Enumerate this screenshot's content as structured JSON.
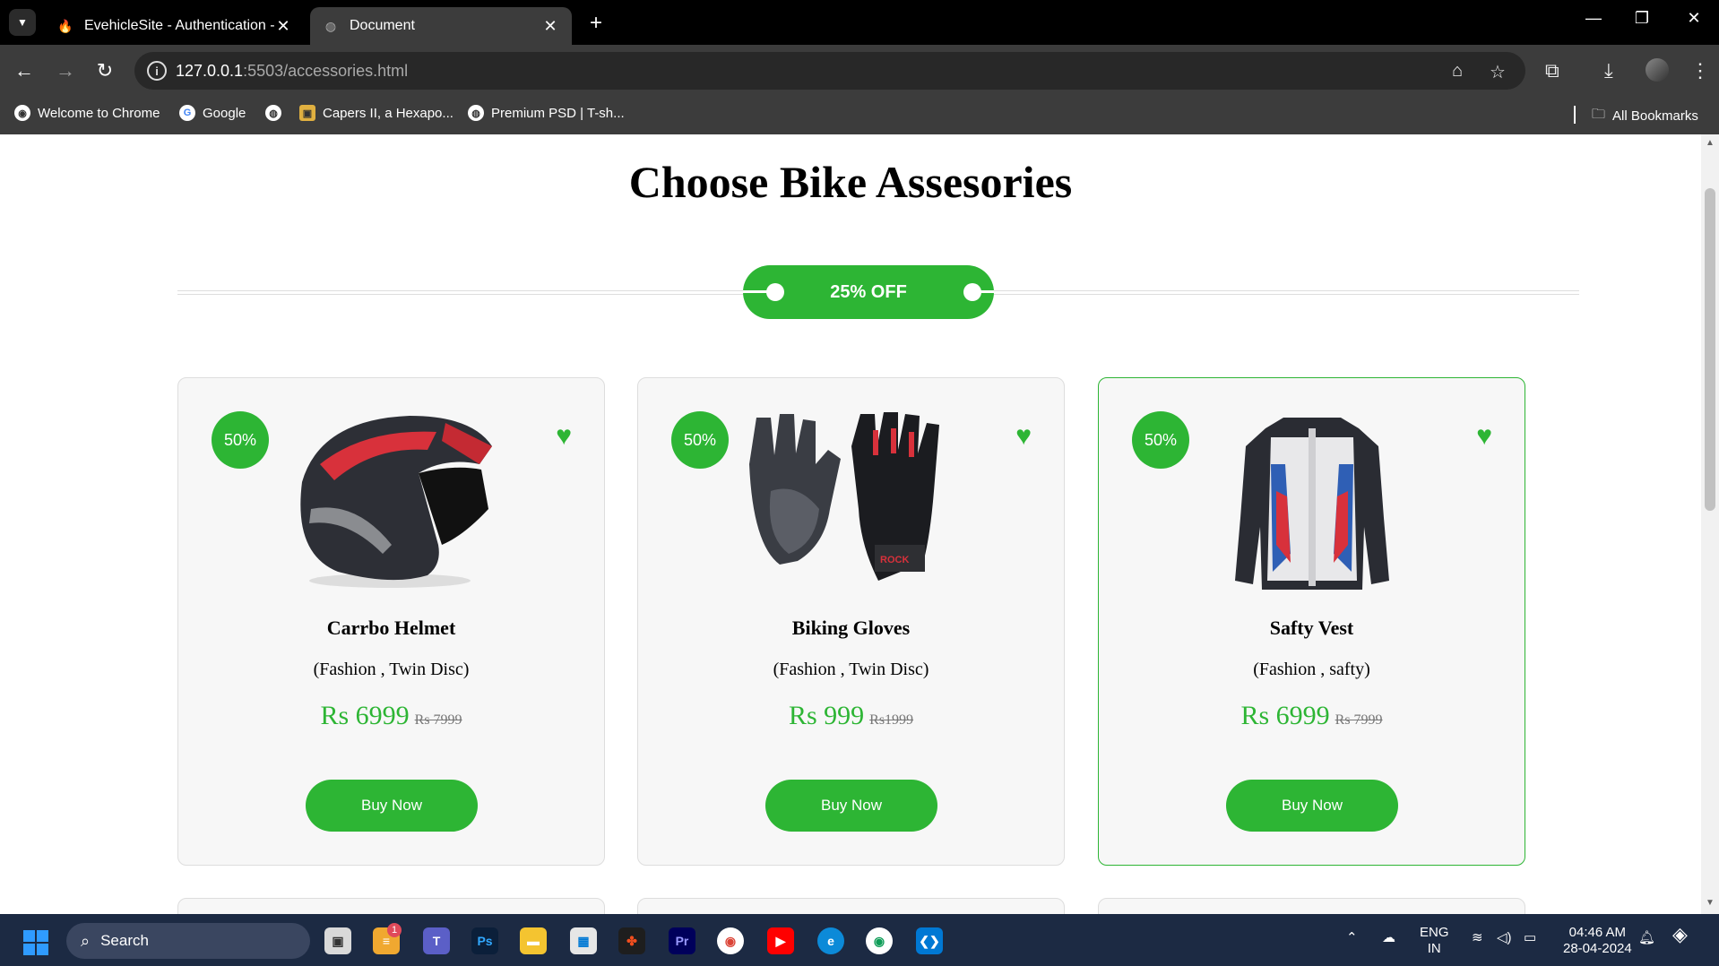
{
  "browser": {
    "tabs": [
      {
        "title": "EvehicleSite - Authentication - F",
        "icon": "firebase-icon",
        "active": false
      },
      {
        "title": "Document",
        "icon": "globe-icon",
        "active": true
      }
    ],
    "url_host": "127.0.0.1",
    "url_path": ":5503/accessories.html",
    "bookmarks": [
      {
        "label": "Welcome to Chrome",
        "icon": "chrome-icon"
      },
      {
        "label": "Google",
        "icon": "google-icon"
      },
      {
        "label": "",
        "icon": "globe-icon"
      },
      {
        "label": "Capers II, a Hexapo...",
        "icon": "image-icon"
      },
      {
        "label": "Premium PSD | T-sh...",
        "icon": "globe-icon"
      }
    ],
    "all_bookmarks": "All Bookmarks"
  },
  "page": {
    "heading": "Choose Bike Assesories",
    "offer_label": "25% OFF",
    "products": [
      {
        "badge": "50%",
        "name": "Carrbo Helmet",
        "desc": "(Fashion , Twin Disc)",
        "price": "Rs 6999",
        "old_price": "Rs 7999",
        "buy_label": "Buy Now",
        "image": "helmet"
      },
      {
        "badge": "50%",
        "name": "Biking Gloves",
        "desc": "(Fashion , Twin Disc)",
        "price": "Rs 999",
        "old_price": "Rs1999",
        "buy_label": "Buy Now",
        "image": "gloves"
      },
      {
        "badge": "50%",
        "name": "Safty Vest",
        "desc": "(Fashion , safty)",
        "price": "Rs 6999",
        "old_price": "Rs 7999",
        "buy_label": "Buy Now",
        "image": "jacket",
        "highlighted": true
      }
    ],
    "accent_color": "#2db534"
  },
  "taskbar": {
    "search_label": "Search",
    "language_top": "ENG",
    "language_bottom": "IN",
    "time": "04:46 AM",
    "date": "28-04-2024",
    "notification_badge": "1"
  }
}
